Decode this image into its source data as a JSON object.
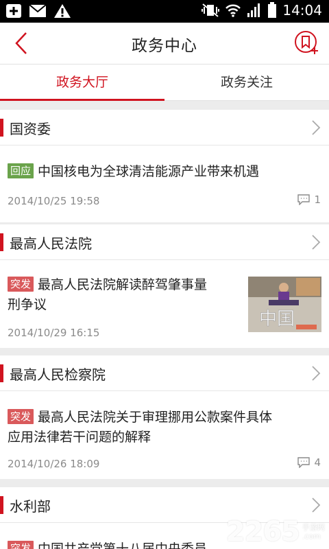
{
  "status_bar": {
    "time": "14:04"
  },
  "header": {
    "title": "政务中心"
  },
  "tabs": [
    {
      "label": "政务大厅",
      "active": true
    },
    {
      "label": "政务关注",
      "active": false
    }
  ],
  "sections": [
    {
      "name": "国资委",
      "item": {
        "badge": "回应",
        "badge_color": "#6aa34b",
        "headline": "中国核电为全球清洁能源产业带来机遇",
        "date": "2014/10/25 19:58",
        "comments": "1"
      }
    },
    {
      "name": "最高人民法院",
      "item": {
        "badge": "突发",
        "badge_color": "#d9595b",
        "headline_line1": "最高人民法院解读醉驾肇事量",
        "headline_line2": "刑争议",
        "date": "2014/10/29 16:15",
        "thumb_text": "中国"
      }
    },
    {
      "name": "最高人民检察院",
      "item": {
        "badge": "突发",
        "badge_color": "#d9595b",
        "headline_line1": "最高人民法院关于审理挪用公款案件具体",
        "headline_line2": "应用法律若干问题的解释",
        "date": "2014/10/26 18:09",
        "comments": "4"
      }
    },
    {
      "name": "水利部",
      "item": {
        "badge": "突发",
        "badge_color": "#d9595b",
        "headline": "中国共产党第十八届中央委员"
      }
    }
  ],
  "watermark": {
    "number": "2265",
    "suffix": ".com",
    "text_top": "手游网"
  },
  "colors": {
    "accent": "#d0131f",
    "divider": "#ececec"
  }
}
